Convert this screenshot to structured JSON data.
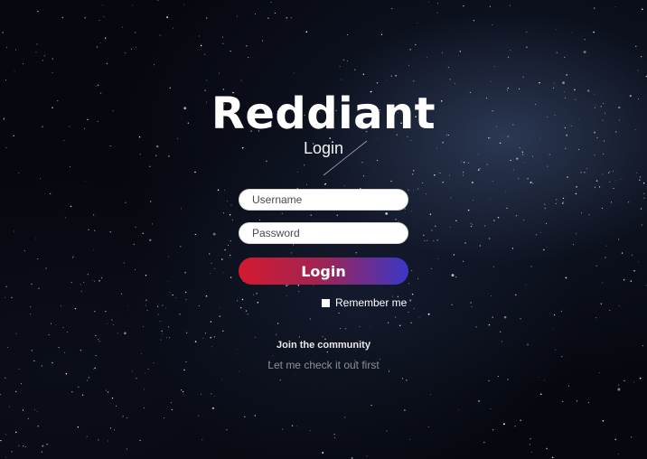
{
  "brand": {
    "title": "Reddiant"
  },
  "header": {
    "subtitle": "Login"
  },
  "form": {
    "username": {
      "placeholder": "Username",
      "value": ""
    },
    "password": {
      "placeholder": "Password",
      "value": ""
    },
    "login_label": "Login",
    "remember": {
      "label": "Remember me",
      "checked": false
    }
  },
  "footer": {
    "join_label": "Join the community",
    "explore_label": "Let me check it out first"
  },
  "colors": {
    "button_gradient_start": "#d31a2f",
    "button_gradient_end": "#3b37c7",
    "background": "#06080f"
  },
  "background": {
    "icon": "starfield-image"
  }
}
